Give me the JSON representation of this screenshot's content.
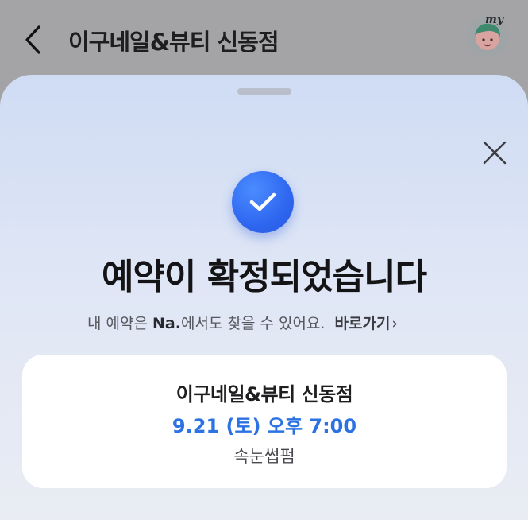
{
  "header": {
    "title": "이구네일&뷰티 신동점",
    "back_icon": "chevron-left-icon",
    "avatar_badge": "my"
  },
  "sheet": {
    "headline": "예약이 확정되었습니다",
    "sub_prefix": "내 예약은",
    "sub_brand": "Na.",
    "sub_suffix": "에서도 찾을 수 있어요.",
    "link_label": "바로가기",
    "link_chevron": "›",
    "check_color": "#2f67f0"
  },
  "booking": {
    "shop_name": "이구네일&뷰티 신동점",
    "datetime": "9.21 (토) 오후 7:00",
    "service": "속눈썹펌",
    "accent": "#2d72e2"
  }
}
